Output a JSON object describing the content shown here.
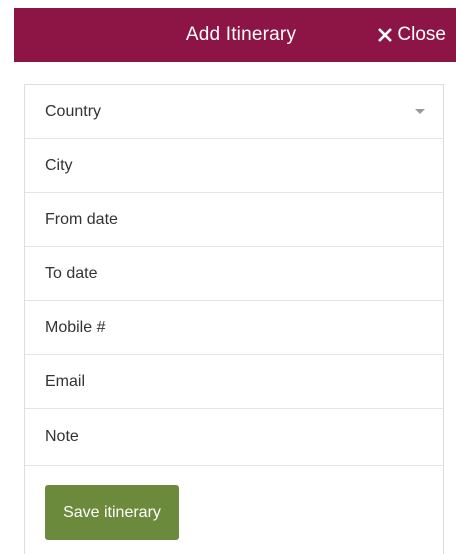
{
  "header": {
    "title": "Add Itinerary",
    "close_label": "Close"
  },
  "form": {
    "fields": [
      {
        "placeholder": "Country",
        "type": "select"
      },
      {
        "placeholder": "City",
        "type": "text"
      },
      {
        "placeholder": "From date",
        "type": "text"
      },
      {
        "placeholder": "To date",
        "type": "text"
      },
      {
        "placeholder": "Mobile #",
        "type": "text"
      },
      {
        "placeholder": "Email",
        "type": "text"
      },
      {
        "placeholder": "Note",
        "type": "text"
      }
    ],
    "save_label": "Save itinerary"
  },
  "colors": {
    "header_bg": "#8d1546",
    "save_button_bg": "#6b8a3c"
  },
  "icons": {
    "close": "close-icon",
    "dropdown": "chevron-down-icon"
  }
}
